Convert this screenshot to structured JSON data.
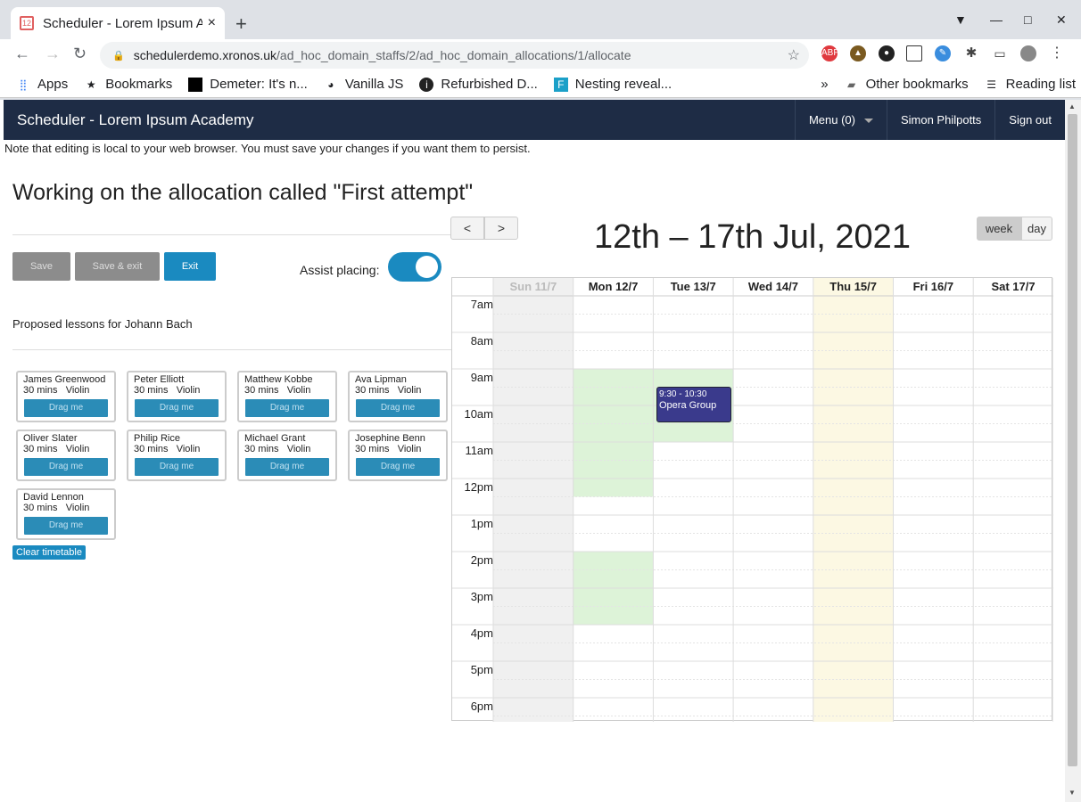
{
  "browser": {
    "tab_title": "Scheduler - Lorem Ipsum A",
    "tab_close": "×",
    "new_tab": "+",
    "url_host": "schedulerdemo.xronos.uk",
    "url_path": "/ad_hoc_domain_staffs/2/ad_hoc_domain_allocations/1/allocate",
    "bookmarks": [
      "Apps",
      "Bookmarks",
      "Demeter: It's n...",
      "Vanilla JS",
      "Refurbished D...",
      "Nesting reveal..."
    ],
    "overflow": "»",
    "other_bookmarks": "Other bookmarks",
    "reading_list": "Reading list"
  },
  "app": {
    "brand": "Scheduler - Lorem Ipsum Academy",
    "menu": "Menu (0)",
    "user": "Simon Philpotts",
    "signout": "Sign out"
  },
  "note": "Note that editing is local to your web browser. You must save your changes if you want them to persist.",
  "heading": "Working on the allocation called \"First attempt\"",
  "buttons": {
    "save": "Save",
    "save_exit": "Save & exit",
    "exit": "Exit"
  },
  "assist_label": "Assist placing:",
  "assist_on": true,
  "proposed_label": "Proposed lessons for Johann Bach",
  "drag_label": "Drag me",
  "lessons": [
    {
      "name": "James Greenwood",
      "mins": "30 mins",
      "inst": "Violin"
    },
    {
      "name": "Peter Elliott",
      "mins": "30 mins",
      "inst": "Violin"
    },
    {
      "name": "Matthew Kobbe",
      "mins": "30 mins",
      "inst": "Violin"
    },
    {
      "name": "Ava Lipman",
      "mins": "30 mins",
      "inst": "Violin"
    },
    {
      "name": "Oliver Slater",
      "mins": "30 mins",
      "inst": "Violin"
    },
    {
      "name": "Philip Rice",
      "mins": "30 mins",
      "inst": "Violin"
    },
    {
      "name": "Michael Grant",
      "mins": "30 mins",
      "inst": "Violin"
    },
    {
      "name": "Josephine Benn",
      "mins": "30 mins",
      "inst": "Violin"
    },
    {
      "name": "David Lennon",
      "mins": "30 mins",
      "inst": "Violin"
    }
  ],
  "clear_label": "Clear timetable",
  "calendar": {
    "prev": "<",
    "next": ">",
    "title": "12th – 17th Jul, 2021",
    "view_week": "week",
    "view_day": "day",
    "days": [
      "Sun 11/7",
      "Mon 12/7",
      "Tue 13/7",
      "Wed 14/7",
      "Thu 15/7",
      "Fri 16/7",
      "Sat 17/7"
    ],
    "times": [
      "7am",
      "8am",
      "9am",
      "10am",
      "11am",
      "12pm",
      "1pm",
      "2pm",
      "3pm",
      "4pm",
      "5pm",
      "6pm"
    ],
    "event_time": "9:30 - 10:30",
    "event_name": "Opera Group",
    "colors": {
      "available": "#ddf3d8",
      "today": "#fcf8e3",
      "sunday": "#f0f0f0",
      "event": "#3a3a8c"
    }
  }
}
